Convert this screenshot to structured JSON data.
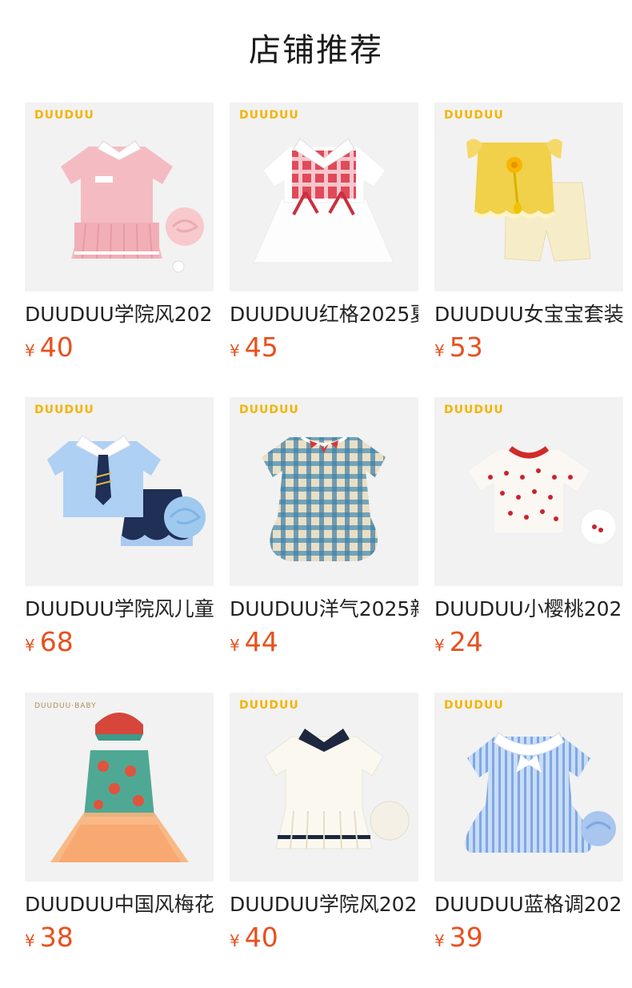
{
  "header": {
    "title": "店铺推荐"
  },
  "currency_symbol": "¥",
  "products": [
    {
      "brand": "DUUDUU",
      "name": "DUUDUU学院风202",
      "price": "40",
      "image": "pink-polo-pleated-dress"
    },
    {
      "brand": "DUUDUU",
      "name": "DUUDUU红格2025夏",
      "price": "45",
      "image": "red-gingham-white-dress"
    },
    {
      "brand": "DUUDUU",
      "name": "DUUDUU女宝宝套装",
      "price": "53",
      "image": "yellow-top-shorts-set"
    },
    {
      "brand": "DUUDUU",
      "name": "DUUDUU学院风儿童",
      "price": "68",
      "image": "blue-shirt-navy-skirt-set"
    },
    {
      "brand": "DUUDUU",
      "name": "DUUDUU洋气2025新",
      "price": "44",
      "image": "blue-plaid-bubble-dress"
    },
    {
      "brand": "DUUDUU",
      "name": "DUUDUU小樱桃202",
      "price": "24",
      "image": "cherry-print-tee"
    },
    {
      "brand": "DUUDUU·BABY",
      "name": "DUUDUU中国风梅花",
      "price": "38",
      "image": "floral-qipao-tulle-dress"
    },
    {
      "brand": "DUUDUU",
      "name": "DUUDUU学院风202",
      "price": "40",
      "image": "white-navy-polo-dress"
    },
    {
      "brand": "DUUDUU",
      "name": "DUUDUU蓝格调202",
      "price": "39",
      "image": "blue-stripe-sailor-dress"
    }
  ],
  "colors": {
    "price": "#e8501e",
    "brand": "#f4b400",
    "thumb_bg": "#f2f2f2"
  }
}
